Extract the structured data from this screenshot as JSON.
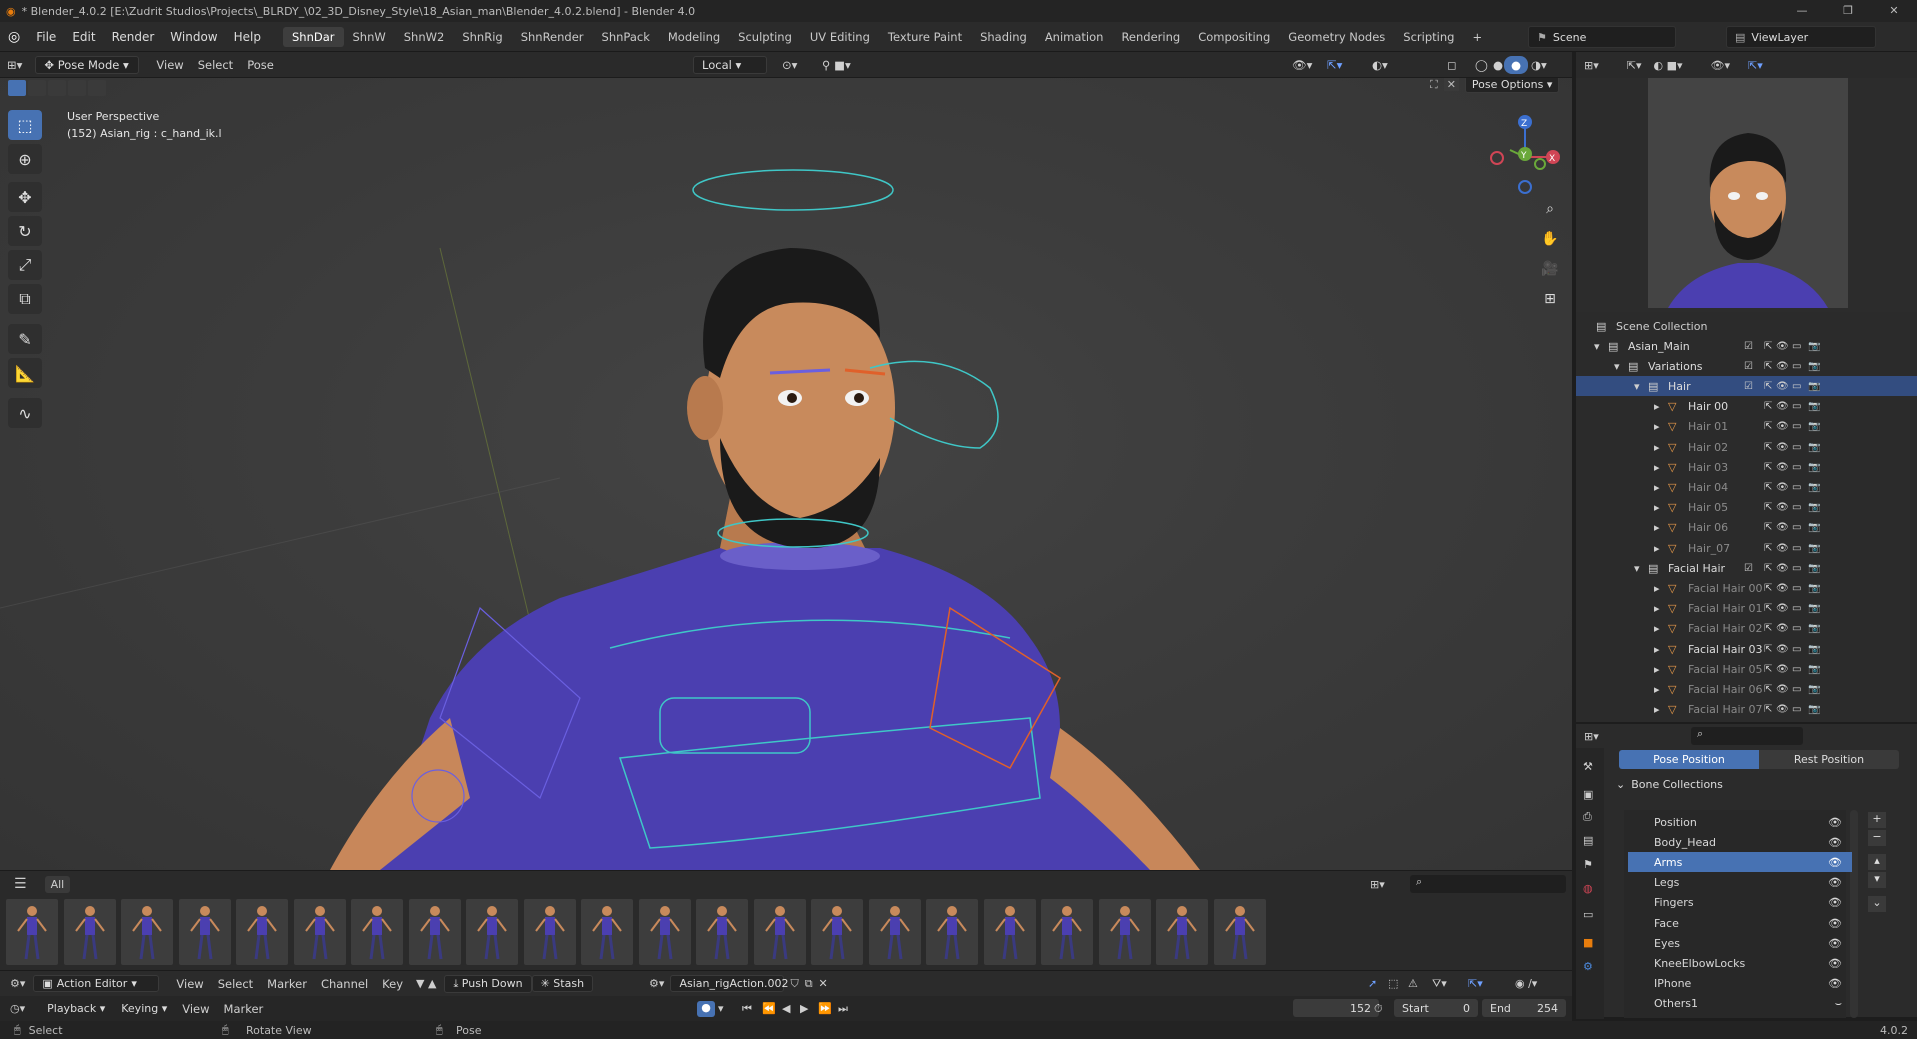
{
  "titlebar": {
    "title": "* Blender_4.0.2 [E:\\Zudrit Studios\\Projects\\_BLRDY_\\02_3D_Disney_Style\\18_Asian_man\\Blender_4.0.2.blend] - Blender 4.0",
    "minimize": "—",
    "maximize": "❐",
    "close": "✕"
  },
  "menus": [
    "File",
    "Edit",
    "Render",
    "Window",
    "Help"
  ],
  "workspaces": [
    "ShnDar",
    "ShnW",
    "ShnW2",
    "ShnRig",
    "ShnRender",
    "ShnPack",
    "Modeling",
    "Sculpting",
    "UV Editing",
    "Texture Paint",
    "Shading",
    "Animation",
    "Rendering",
    "Compositing",
    "Geometry Nodes",
    "Scripting"
  ],
  "active_workspace": "ShnDar",
  "add_workspace": "+",
  "scene_field": "Scene",
  "viewlayer_field": "ViewLayer",
  "viewport_header": {
    "mode": "Pose Mode",
    "menus": [
      "View",
      "Select",
      "Pose"
    ],
    "transform_orientation": "Local",
    "pose_options": "Pose Options"
  },
  "viewport": {
    "perspective": "User Perspective",
    "active_info": "(152) Asian_rig : c_hand_ik.l",
    "gizmo": {
      "z": "Z",
      "y": "Y",
      "x": "X"
    }
  },
  "tools": [
    "select-box",
    "cursor",
    "move",
    "rotate",
    "scale",
    "transform",
    "annotate",
    "measure",
    "relax"
  ],
  "outliner": {
    "root": "Scene Collection",
    "rows": [
      {
        "label": "Asian_Main",
        "level": 1,
        "type": "collection"
      },
      {
        "label": "Variations",
        "level": 2,
        "type": "collection"
      },
      {
        "label": "Hair",
        "level": 3,
        "type": "collection",
        "selected": true
      },
      {
        "label": "Hair 00",
        "level": 4,
        "type": "mesh",
        "visible": true
      },
      {
        "label": "Hair 01",
        "level": 4,
        "type": "mesh"
      },
      {
        "label": "Hair 02",
        "level": 4,
        "type": "mesh"
      },
      {
        "label": "Hair 03",
        "level": 4,
        "type": "mesh"
      },
      {
        "label": "Hair 04",
        "level": 4,
        "type": "mesh"
      },
      {
        "label": "Hair 05",
        "level": 4,
        "type": "mesh"
      },
      {
        "label": "Hair 06",
        "level": 4,
        "type": "mesh"
      },
      {
        "label": "Hair_07",
        "level": 4,
        "type": "mesh"
      },
      {
        "label": "Facial Hair",
        "level": 3,
        "type": "collection"
      },
      {
        "label": "Facial Hair 00",
        "level": 4,
        "type": "mesh"
      },
      {
        "label": "Facial Hair 01",
        "level": 4,
        "type": "mesh"
      },
      {
        "label": "Facial Hair 02",
        "level": 4,
        "type": "mesh"
      },
      {
        "label": "Facial Hair 03",
        "level": 4,
        "type": "mesh",
        "visible": true
      },
      {
        "label": "Facial Hair 05",
        "level": 4,
        "type": "mesh"
      },
      {
        "label": "Facial Hair 06",
        "level": 4,
        "type": "mesh"
      },
      {
        "label": "Facial Hair 07",
        "level": 4,
        "type": "mesh"
      }
    ]
  },
  "properties": {
    "pose_position": "Pose Position",
    "rest_position": "Rest Position",
    "panel_title": "Bone Collections",
    "bone_collections": [
      "Position",
      "Body_Head",
      "Arms",
      "Legs",
      "Fingers",
      "Face",
      "Eyes",
      "KneeElbowLocks",
      "IPhone",
      "Others1"
    ],
    "selected_collection": "Arms"
  },
  "assetbar": {
    "filter": "All",
    "thumb_count": 22
  },
  "action_editor": {
    "editor": "Action Editor",
    "menus": [
      "View",
      "Select",
      "Marker",
      "Channel",
      "Key"
    ],
    "push_down": "Push Down",
    "stash": "Stash",
    "action": "Asian_rigAction.002"
  },
  "timeline": {
    "menus": [
      "Playback",
      "Keying",
      "View",
      "Marker"
    ],
    "current_frame": "152",
    "start_label": "Start",
    "start": "0",
    "end_label": "End",
    "end": "254"
  },
  "status": {
    "select": "Select",
    "rotate": "Rotate View",
    "pose": "Pose",
    "version": "4.0.2"
  },
  "colors": {
    "accent": "#4772b3",
    "rig_cyan": "#3fc7c7",
    "rig_orange": "#e0602a",
    "shirt": "#4b3fb0"
  }
}
